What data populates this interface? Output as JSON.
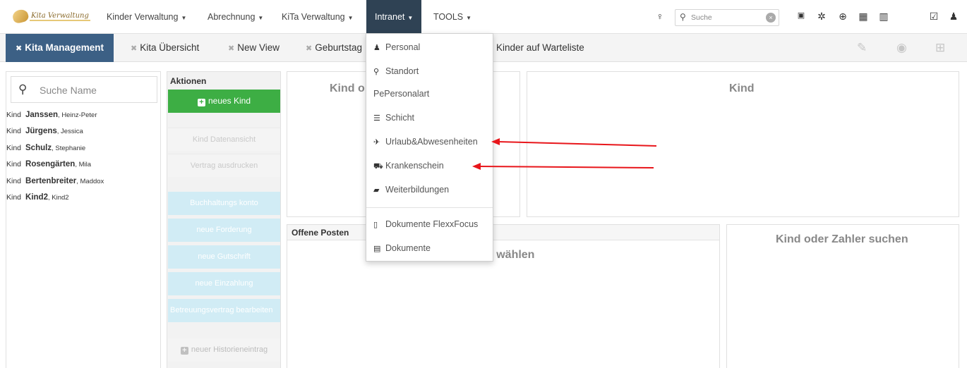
{
  "app": {
    "logo_text": "Kita Verwaltung"
  },
  "nav": {
    "items": [
      {
        "label": "Kinder Verwaltung"
      },
      {
        "label": "Abrechnung"
      },
      {
        "label": "KiTa Verwaltung"
      },
      {
        "label": "Intranet"
      },
      {
        "label": "TOOLS"
      }
    ],
    "search_placeholder": "Suche",
    "icons": [
      "lightbulb-icon",
      "search-icon",
      "clear-icon",
      "clipboard-icon",
      "gear-icon",
      "circle-plus-icon",
      "calendar-icon",
      "bar-chart-icon",
      "checkbox-icon",
      "user-icon"
    ]
  },
  "tabs": [
    {
      "label": "Kita Management"
    },
    {
      "label": "Kita Übersicht"
    },
    {
      "label": "New View"
    },
    {
      "label": "Geburtstag"
    },
    {
      "label": "Kinder auf Warteliste"
    }
  ],
  "tab_tools": [
    "pencil-icon",
    "eye-icon",
    "add-box-icon"
  ],
  "left_panel": {
    "search_placeholder": "Suche Name",
    "prefix": "Kind",
    "children": [
      {
        "last": "Janssen",
        "first": ", Heinz-Peter"
      },
      {
        "last": "Jürgens",
        "first": ", Jessica"
      },
      {
        "last": "Schulz",
        "first": ", Stephanie"
      },
      {
        "last": "Rosengärten",
        "first": ", Mila"
      },
      {
        "last": "Bertenbreiter",
        "first": ", Maddox"
      },
      {
        "last": "Kind2",
        "first": ", Kind2"
      }
    ]
  },
  "actions": {
    "title": "Aktionen",
    "new_child": "neues Kind",
    "kind_datenansicht": "Kind Datenansicht",
    "vertrag_ausdrucken": "Vertrag ausdrucken",
    "buchhaltungs_konto": "Buchhaltungs konto",
    "neue_forderung": "neue Forderung",
    "neue_gutschrift": "neue Gutschrift",
    "neue_einzahlung": "neue Einzahlung",
    "betreuungsvertrag": "Betreuungsvertrag bearbeiten",
    "neuer_historieneintrag": "neuer Historieneintrag"
  },
  "panels": {
    "kind_oder_partial": "Kind o",
    "kind": "Kind",
    "offene_posten": "Offene Posten",
    "wahlen_partial": "g wählen",
    "kind_oder_zahler": "Kind oder Zahler suchen"
  },
  "dropdown": {
    "items": [
      {
        "icon": "user-icon",
        "glyph": "♟",
        "label": "Personal"
      },
      {
        "icon": "map-marker-icon",
        "glyph": "⚲",
        "label": "Standort"
      },
      {
        "icon": "pe-text-icon",
        "glyph": "Pe",
        "label": "Personalart"
      },
      {
        "icon": "list-icon",
        "glyph": "☰",
        "label": "Schicht"
      },
      {
        "icon": "plane-icon",
        "glyph": "✈",
        "label": "Urlaub&Abwesenheiten"
      },
      {
        "icon": "ambulance-icon",
        "glyph": "⛟",
        "label": "Krankenschein"
      },
      {
        "icon": "book-icon",
        "glyph": "▰",
        "label": "Weiterbildungen"
      },
      {
        "icon": "document-icon",
        "glyph": "▯",
        "label": "Dokumente FlexxFocus"
      },
      {
        "icon": "file-icon",
        "glyph": "▤",
        "label": "Dokumente"
      }
    ]
  },
  "colors": {
    "nav_active": "#2f4254",
    "tab_active": "#3c6085",
    "green_button": "#3dae44",
    "light_blue_button": "#d1ecf5",
    "annotation_arrow": "#e8161b"
  }
}
